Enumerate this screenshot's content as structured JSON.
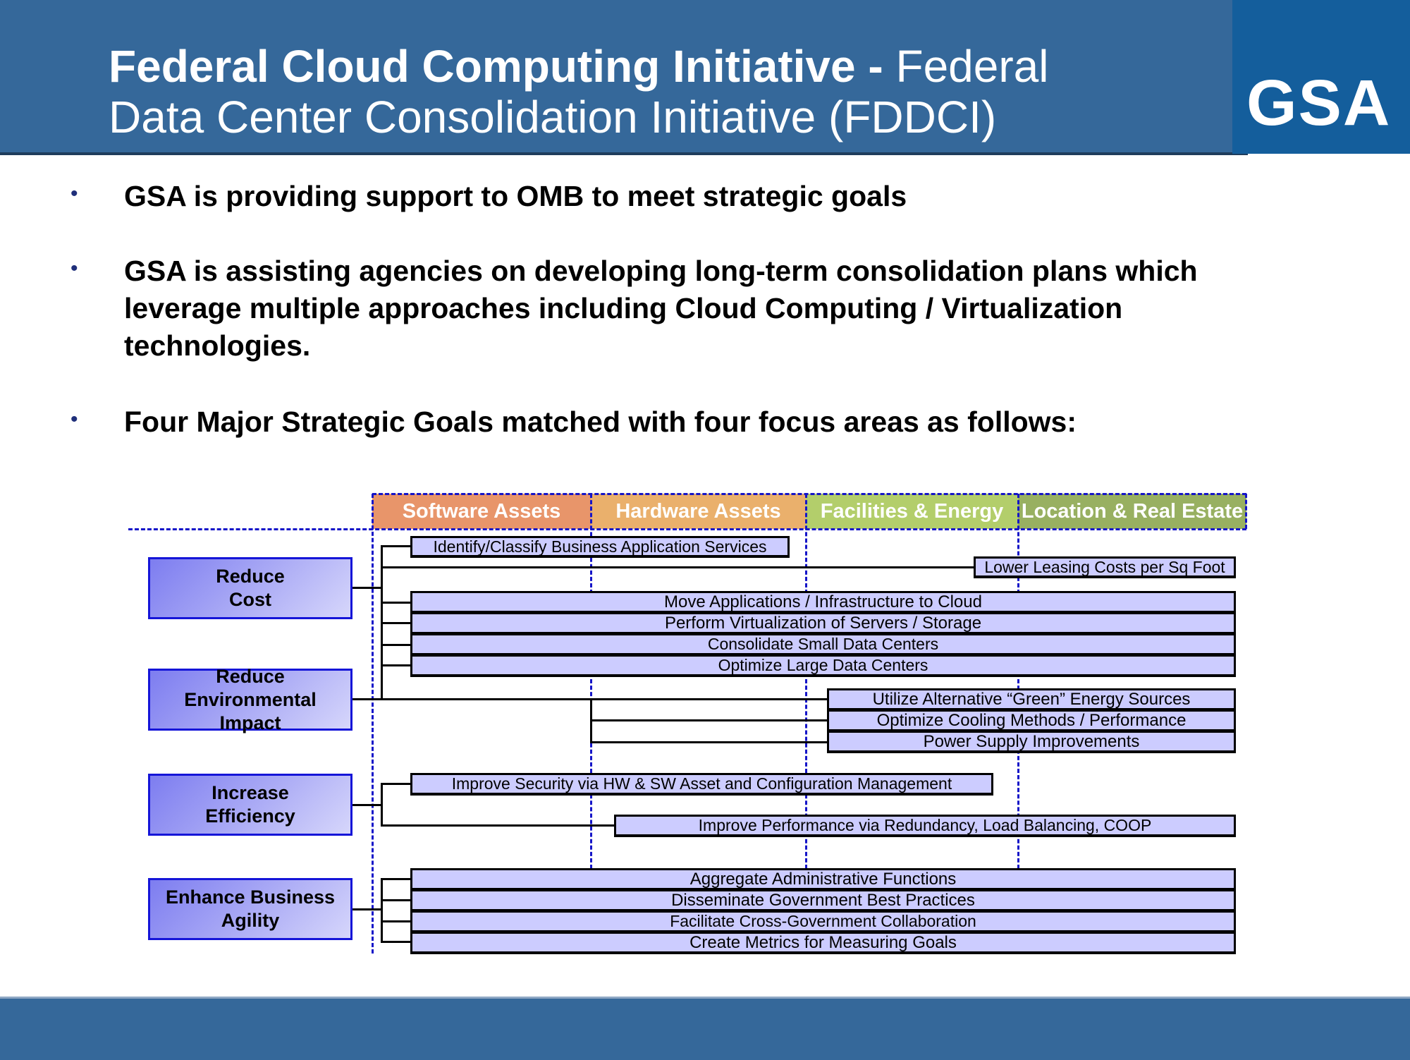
{
  "header": {
    "title_bold": "Federal Cloud Computing Initiative -",
    "title_regular_line1": " Federal",
    "title_line2": "Data Center Consolidation Initiative (FDDCI)",
    "logo_text": "GSA",
    "logo_star": "★"
  },
  "bullets": [
    {
      "marker": "•",
      "text": "GSA is providing support to OMB to meet strategic goals"
    },
    {
      "marker": "•",
      "lines": [
        "GSA is assisting agencies on developing long-term consolidation plans which",
        "leverage multiple approaches including Cloud Computing / Virtualization",
        "technologies."
      ]
    },
    {
      "marker": "•",
      "text": "Four Major Strategic Goals matched with four focus areas as follows:"
    }
  ],
  "diagram": {
    "focus_areas": [
      {
        "label": "Software Assets",
        "color": "#E8956A"
      },
      {
        "label": "Hardware Assets",
        "color": "#EAB06C"
      },
      {
        "label": "Facilities & Energy",
        "color": "#B3CE6B"
      },
      {
        "label": "Location & Real Estate",
        "color": "#98B061"
      }
    ],
    "goals": [
      {
        "label_lines": [
          "Reduce",
          "Cost"
        ]
      },
      {
        "label_lines": [
          "Reduce",
          "Environmental",
          "Impact"
        ]
      },
      {
        "label_lines": [
          "Increase",
          "Efficiency"
        ]
      },
      {
        "label_lines": [
          "Enhance Business",
          "Agility"
        ]
      }
    ],
    "items": [
      "Identify/Classify Business Application Services",
      "Lower Leasing Costs per Sq Foot",
      "Move Applications / Infrastructure to Cloud",
      "Perform Virtualization of Servers / Storage",
      "Consolidate Small Data Centers",
      "Optimize Large Data Centers",
      "Utilize Alternative “Green” Energy Sources",
      "Optimize Cooling Methods / Performance",
      "Power Supply Improvements",
      "Improve Security via HW & SW Asset and Configuration Management",
      "Improve Performance via Redundancy, Load Balancing, COOP",
      "Aggregate Administrative Functions",
      "Disseminate Government Best Practices",
      "Facilitate Cross-Government Collaboration",
      "Create Metrics for Measuring Goals"
    ]
  }
}
